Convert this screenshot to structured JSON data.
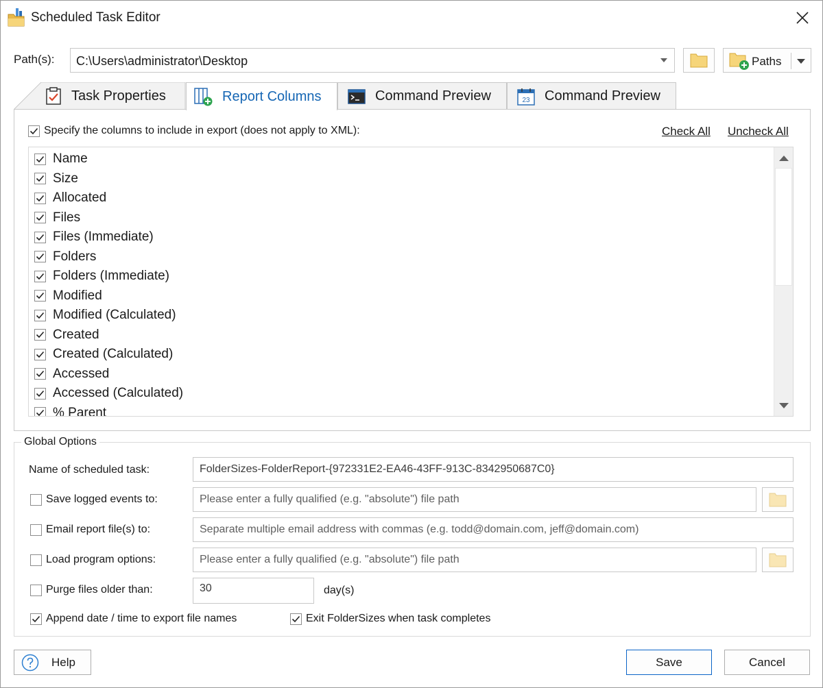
{
  "window": {
    "title": "Scheduled Task Editor"
  },
  "path_row": {
    "label": "Path(s):",
    "value": "C:\\Users\\administrator\\Desktop",
    "paths_button_label": "Paths"
  },
  "tabs": [
    {
      "label": "Task Properties",
      "icon": "clipboard-check-icon",
      "active": false
    },
    {
      "label": "Report Columns",
      "icon": "columns-add-icon",
      "active": true
    },
    {
      "label": "Command Preview",
      "icon": "console-icon",
      "active": false
    },
    {
      "label": "Command Preview",
      "icon": "calendar-icon",
      "active": false
    }
  ],
  "columns_panel": {
    "specify_label": "Specify the columns to include in export (does not apply to XML):",
    "specify_checked": true,
    "check_all": "Check All",
    "uncheck_all": "Uncheck All",
    "items": [
      {
        "label": "Name",
        "checked": true
      },
      {
        "label": "Size",
        "checked": true
      },
      {
        "label": "Allocated",
        "checked": true
      },
      {
        "label": "Files",
        "checked": true
      },
      {
        "label": "Files (Immediate)",
        "checked": true
      },
      {
        "label": "Folders",
        "checked": true
      },
      {
        "label": "Folders (Immediate)",
        "checked": true
      },
      {
        "label": "Modified",
        "checked": true
      },
      {
        "label": "Modified (Calculated)",
        "checked": true
      },
      {
        "label": "Created",
        "checked": true
      },
      {
        "label": "Created (Calculated)",
        "checked": true
      },
      {
        "label": "Accessed",
        "checked": true
      },
      {
        "label": "Accessed (Calculated)",
        "checked": true
      },
      {
        "label": "% Parent",
        "checked": true
      }
    ]
  },
  "global_options": {
    "title": "Global Options",
    "task_name_label": "Name of scheduled task:",
    "task_name_value": "FolderSizes-FolderReport-{972331E2-EA46-43FF-913C-8342950687C0}",
    "save_events_label": "Save logged events to:",
    "save_events_placeholder": "Please enter a fully qualified (e.g. \"absolute\") file path",
    "email_label": "Email report file(s) to:",
    "email_placeholder": "Separate multiple email address with commas (e.g. todd@domain.com, jeff@domain.com)",
    "load_options_label": "Load program options:",
    "load_options_placeholder": "Please enter a fully qualified (e.g. \"absolute\") file path",
    "purge_label": "Purge files older than:",
    "purge_value": "30",
    "purge_unit": "day(s)",
    "append_date_label": "Append date / time to export file names",
    "exit_label": "Exit FolderSizes when task completes"
  },
  "buttons": {
    "help": "Help",
    "save": "Save",
    "cancel": "Cancel"
  },
  "colors": {
    "active_tab_text": "#1566b4",
    "folder_yellow": "#f6d57a",
    "primary_border": "#0a64c8"
  }
}
